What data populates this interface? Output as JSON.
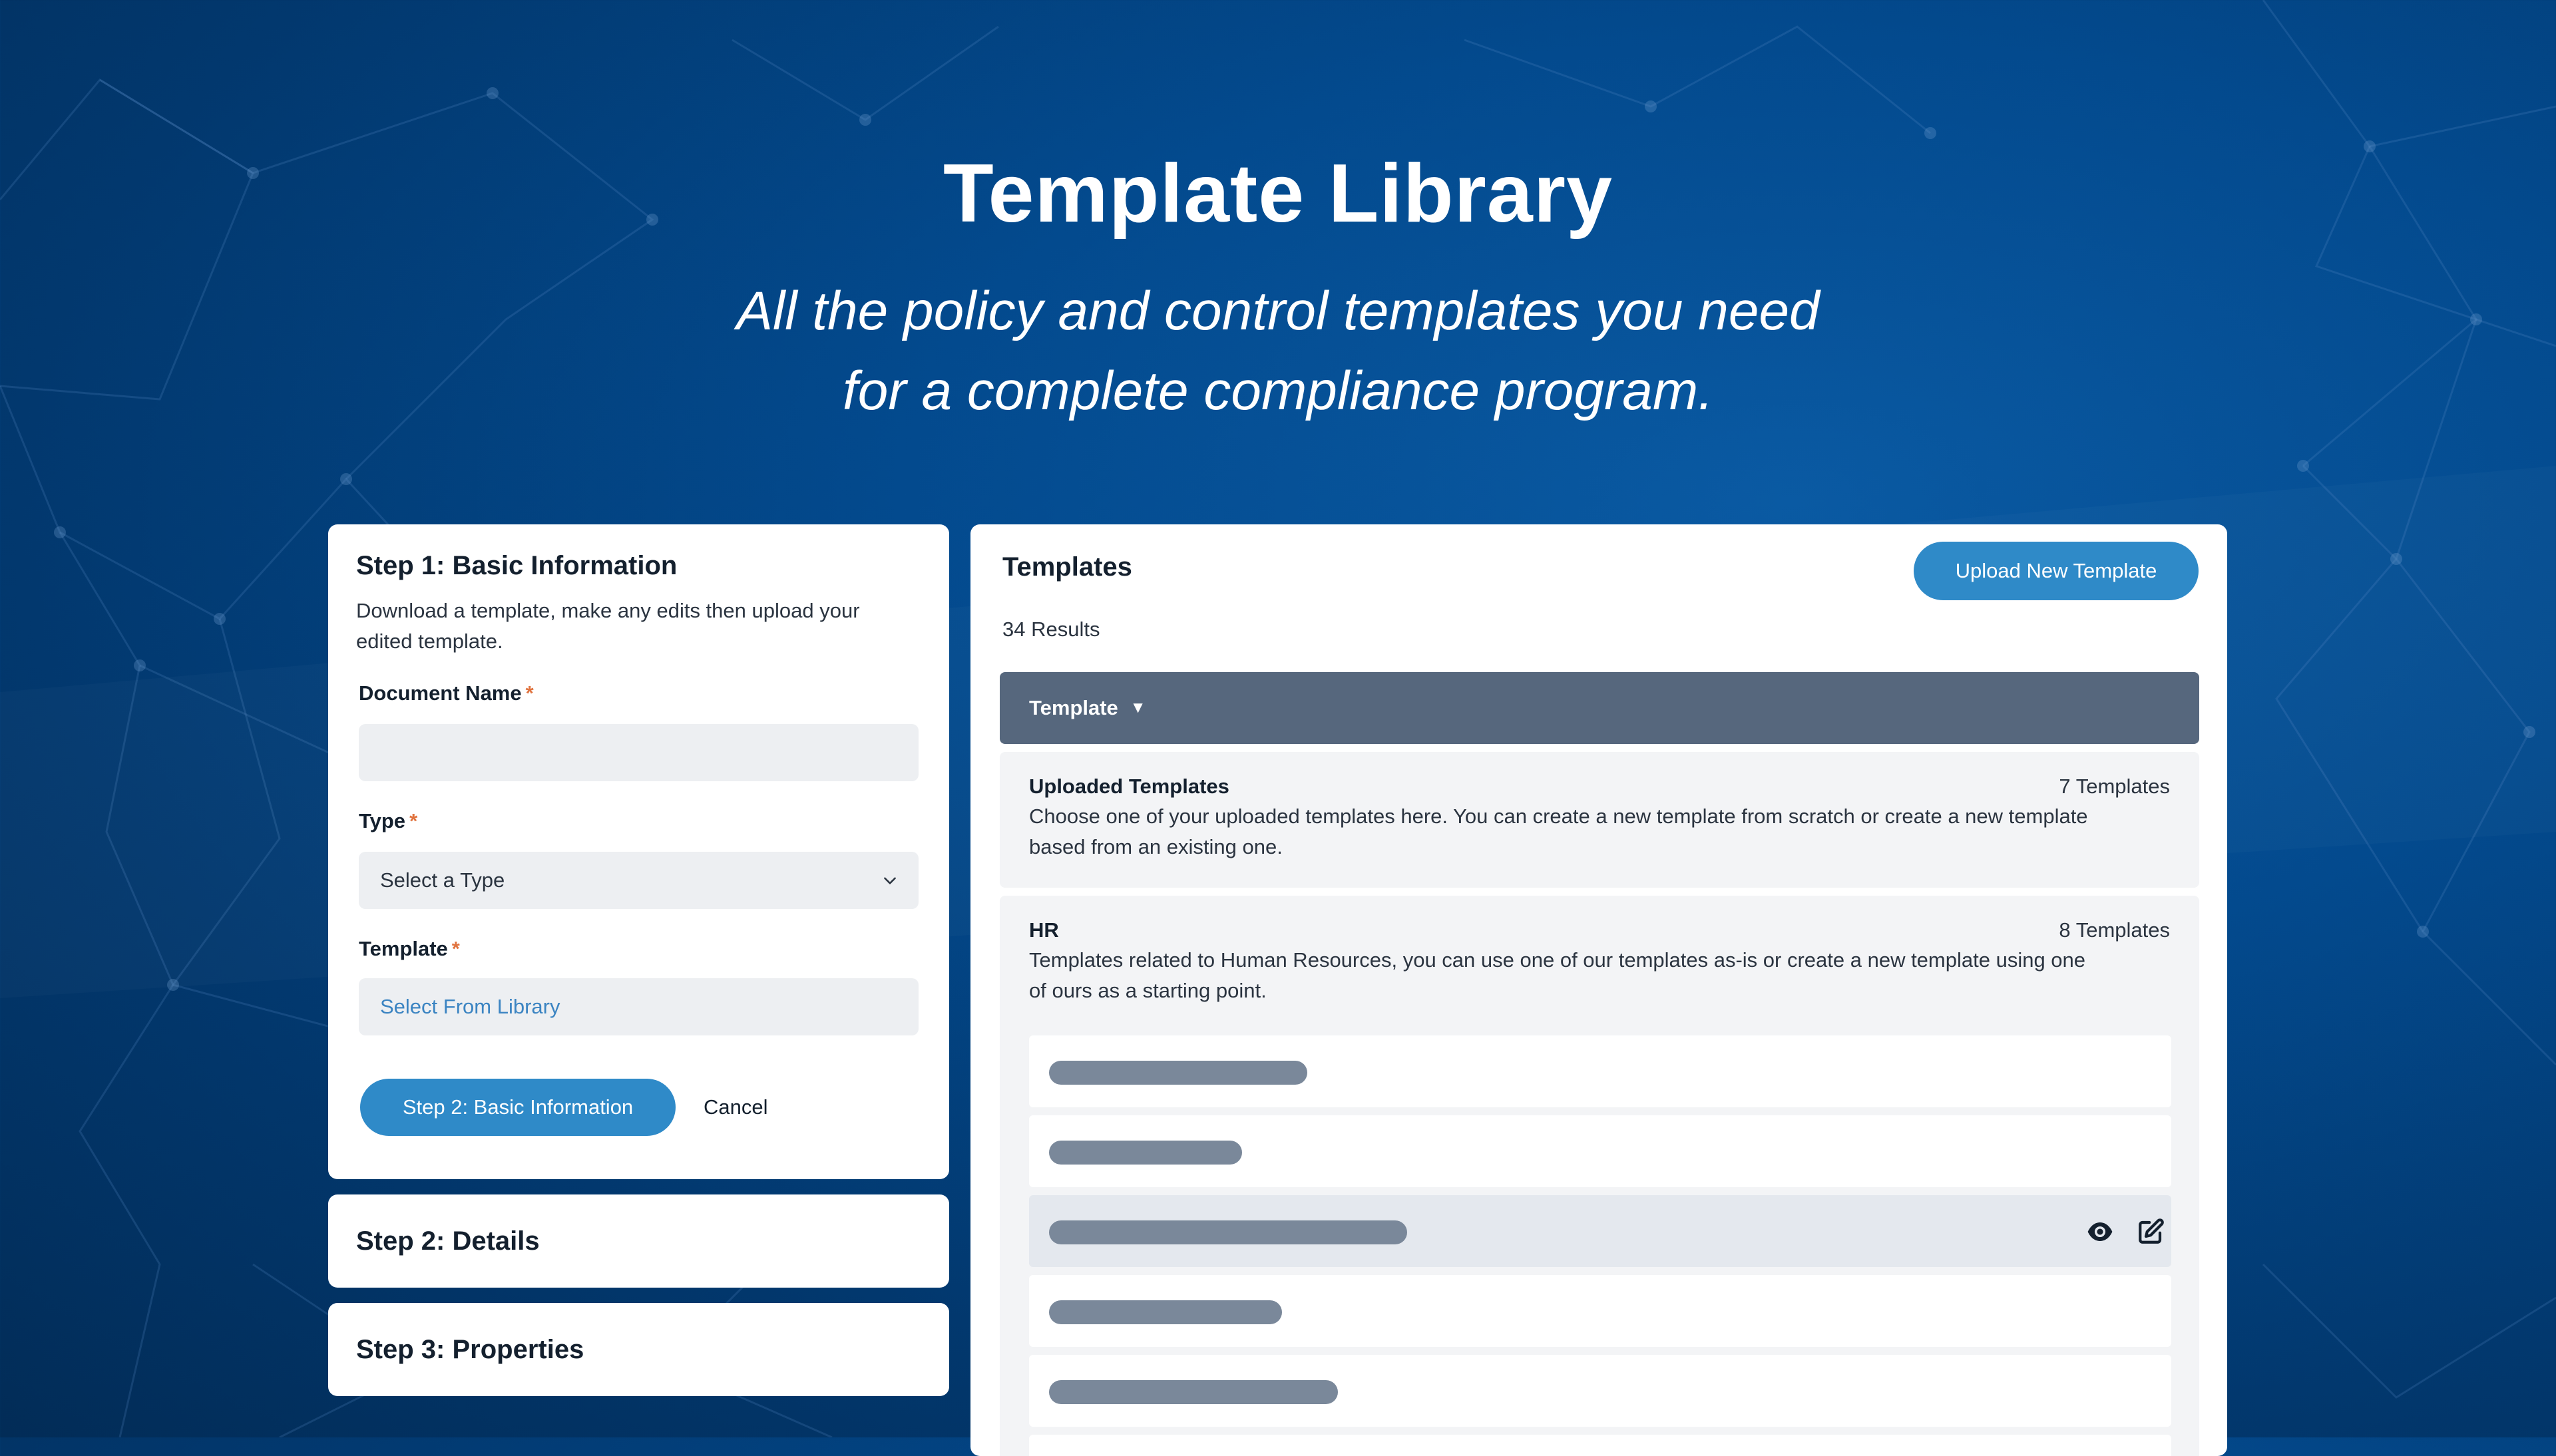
{
  "hero": {
    "title": "Template Library",
    "subtitle_line1": "All the policy and control templates you need",
    "subtitle_line2": "for a complete compliance program."
  },
  "wizard": {
    "step1": {
      "title": "Step 1: Basic Information",
      "description": "Download a template, make any edits then upload your edited template.",
      "document_name_label": "Document Name",
      "document_name_value": "",
      "type_label": "Type",
      "type_value": "Select a Type",
      "template_label": "Template",
      "template_value": "Select From Library",
      "required_marker": "*",
      "next_button": "Step 2: Basic Information",
      "cancel_button": "Cancel"
    },
    "step2": {
      "title": "Step 2: Details"
    },
    "step3": {
      "title": "Step 3: Properties"
    }
  },
  "templates": {
    "title": "Templates",
    "upload_button": "Upload New Template",
    "results": "34 Results",
    "column_header": "Template",
    "sort_indicator": "▼",
    "groups": [
      {
        "name": "Uploaded Templates",
        "count": "7 Templates",
        "description": "Choose one of your uploaded templates here. You can create a new template from scratch or create a new template based from an existing one."
      },
      {
        "name": "HR",
        "count": "8 Templates",
        "description": "Templates related to Human Resources, you can use one of our templates as-is or create a new template using one of ours as a starting point."
      }
    ],
    "row_icons": [
      "eye-icon",
      "edit-icon"
    ]
  },
  "colors": {
    "primary_button": "#2f8ac8",
    "table_header": "#56677d",
    "required_marker": "#e0733f",
    "placeholder_pill": "#7a889a"
  }
}
